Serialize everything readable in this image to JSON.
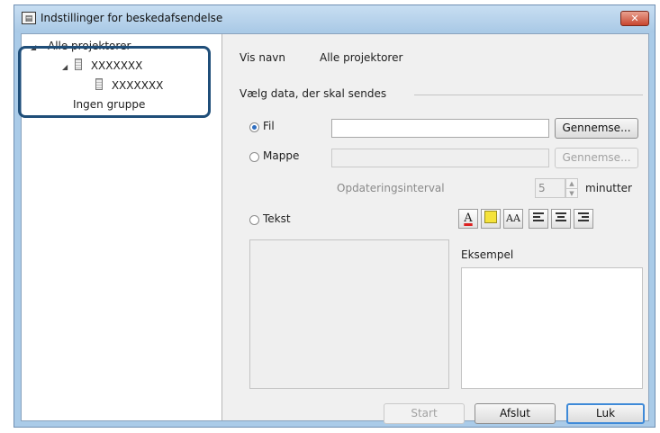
{
  "window": {
    "title": "Indstillinger for beskedafsendelse",
    "close_label": "✕"
  },
  "tree": {
    "root_label": "Alle projektorer",
    "group_label": "XXXXXXX",
    "child_label": "XXXXXXX",
    "no_group_label": "Ingen gruppe"
  },
  "main": {
    "display_name_label": "Vis navn",
    "display_name_value": "Alle projektorer",
    "select_data_label": "Vælg data, der skal sendes",
    "file_option": "Fil",
    "file_value": "",
    "browse_label": "Gennemse...",
    "folder_option": "Mappe",
    "folder_value": "",
    "folder_browse_label": "Gennemse...",
    "update_interval_label": "Opdateringsinterval",
    "update_interval_value": "5",
    "minutes_label": "minutter",
    "text_option": "Tekst",
    "example_label": "Eksempel"
  },
  "toolbar": {
    "font_color_glyph": "A",
    "font_size_glyph": "AA"
  },
  "footer": {
    "start_label": "Start",
    "finish_label": "Afslut",
    "close_label": "Luk"
  },
  "colors": {
    "accent": "#3f8ad8",
    "highlight": "#1f4e79",
    "title_bar": "#aacbe8",
    "close_button": "#c8462f"
  }
}
